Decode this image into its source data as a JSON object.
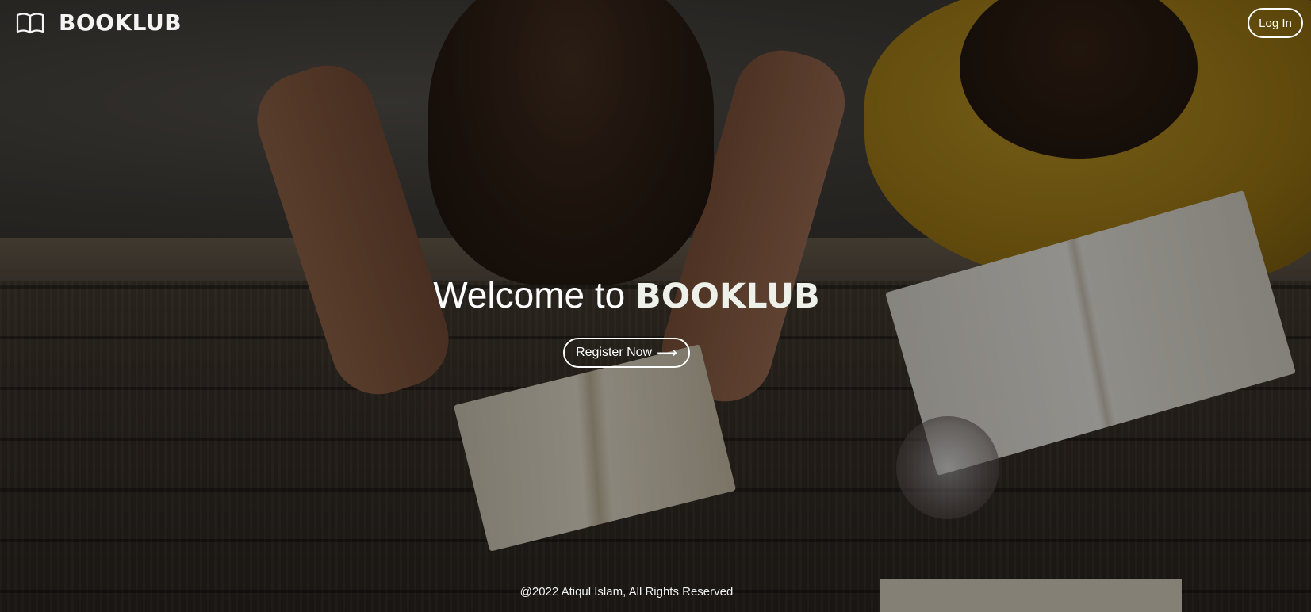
{
  "header": {
    "brand_icon": "open-book-icon",
    "brand_name": "BOOKLUB",
    "login_label": "Log In"
  },
  "hero": {
    "title_prefix": "Welcome to ",
    "title_brand": "BOOKLUB",
    "register_label": "Register Now",
    "register_icon": "arrow-right-icon",
    "register_arrow": "⟶"
  },
  "footer": {
    "copyright": "@2022 Atiqul Islam, All Rights Reserved"
  },
  "colors": {
    "text": "#ffffff",
    "overlay": "rgba(0,0,0,0.42)"
  }
}
